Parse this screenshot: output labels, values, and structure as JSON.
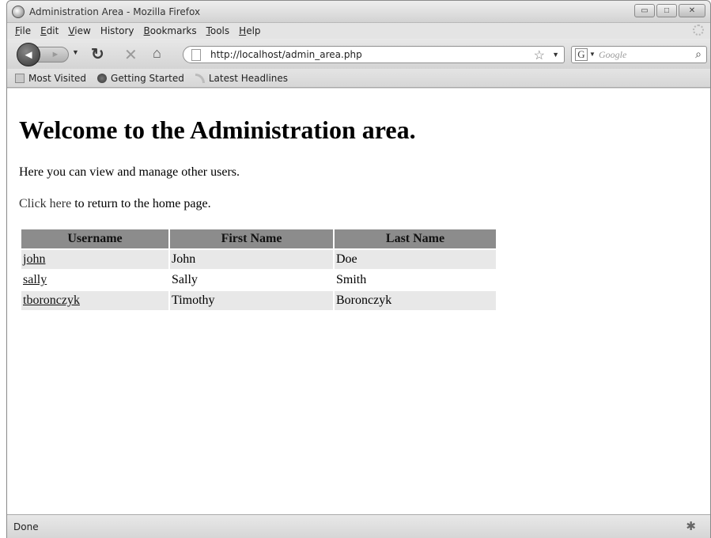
{
  "window": {
    "title": "Administration Area - Mozilla Firefox",
    "controls": {
      "minimize": "▭",
      "maximize": "□",
      "close": "✕"
    }
  },
  "menu": [
    {
      "underlined": "F",
      "rest": "ile"
    },
    {
      "underlined": "E",
      "rest": "dit"
    },
    {
      "underlined": "V",
      "rest": "iew"
    },
    {
      "underlined": "",
      "rest": "History"
    },
    {
      "underlined": "B",
      "rest": "ookmarks"
    },
    {
      "underlined": "T",
      "rest": "ools"
    },
    {
      "underlined": "H",
      "rest": "elp"
    }
  ],
  "nav": {
    "url": "http://localhost/admin_area.php",
    "search_placeholder": "Google",
    "search_engine_letter": "G"
  },
  "bookmarks": [
    {
      "label": "Most Visited",
      "icon": "bookmark-folder-icon"
    },
    {
      "label": "Getting Started",
      "icon": "firefox-icon"
    },
    {
      "label": "Latest Headlines",
      "icon": "rss-feed-icon"
    }
  ],
  "page": {
    "heading": "Welcome to the Administration area.",
    "intro": "Here you can view and manage other users.",
    "return_link": "Click here",
    "return_rest": " to return to the home page."
  },
  "users_table": {
    "headers": [
      "Username",
      "First Name",
      "Last Name"
    ],
    "rows": [
      [
        "john",
        "John",
        "Doe"
      ],
      [
        "sally",
        "Sally",
        "Smith"
      ],
      [
        "tboronczyk",
        "Timothy",
        "Boronczyk"
      ]
    ]
  },
  "status": {
    "text": "Done"
  }
}
